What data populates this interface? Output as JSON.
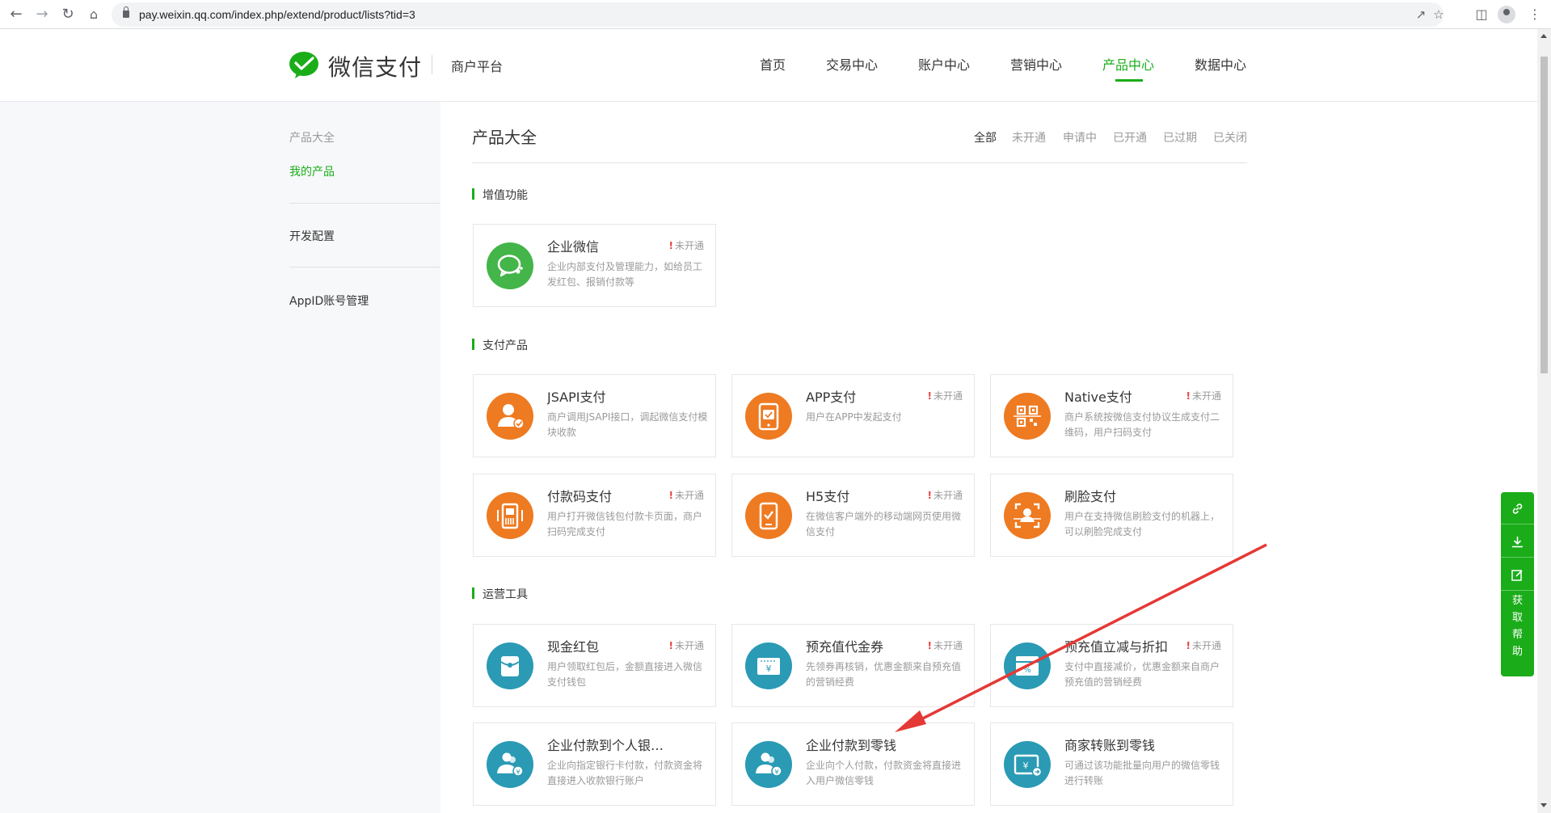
{
  "browser": {
    "url": "pay.weixin.qq.com/index.php/extend/product/lists?tid=3"
  },
  "header": {
    "logo_text": "微信支付",
    "portal": "商户平台",
    "nav": [
      "首页",
      "交易中心",
      "账户中心",
      "营销中心",
      "产品中心",
      "数据中心"
    ],
    "active_nav": "产品中心"
  },
  "sidebar": {
    "title": "产品大全",
    "items": [
      "我的产品",
      "开发配置",
      "AppID账号管理"
    ],
    "active_item": "我的产品"
  },
  "main": {
    "title": "产品大全",
    "filters": [
      "全部",
      "未开通",
      "申请中",
      "已开通",
      "已过期",
      "已关闭"
    ],
    "active_filter": "全部"
  },
  "sections": [
    {
      "title": "增值功能",
      "cards": [
        {
          "name": "企业微信",
          "status": "未开通",
          "desc": "企业内部支付及管理能力，如给员工发红包、报销付款等",
          "icon": "wework-icon",
          "color": "#44b549"
        }
      ]
    },
    {
      "title": "支付产品",
      "cards": [
        {
          "name": "JSAPI支付",
          "status": "",
          "desc": "商户调用JSAPI接口，调起微信支付模块收款",
          "icon": "jsapi-user-icon",
          "color": "#ee7a21"
        },
        {
          "name": "APP支付",
          "status": "未开通",
          "desc": "用户在APP中发起支付",
          "icon": "app-phone-icon",
          "color": "#ee7a21"
        },
        {
          "name": "Native支付",
          "status": "未开通",
          "desc": "商户系统按微信支付协议生成支付二维码，用户扫码支付",
          "icon": "qrcode-icon",
          "color": "#ee7a21"
        },
        {
          "name": "付款码支付",
          "status": "未开通",
          "desc": "用户打开微信钱包付款卡页面，商户扫码完成支付",
          "icon": "barcode-scanner-icon",
          "color": "#ee7a21"
        },
        {
          "name": "H5支付",
          "status": "未开通",
          "desc": "在微信客户端外的移动端网页使用微信支付",
          "icon": "h5-phone-icon",
          "color": "#ee7a21"
        },
        {
          "name": "刷脸支付",
          "status": "",
          "desc": "用户在支持微信刷脸支付的机器上，可以刷脸完成支付",
          "icon": "face-pay-icon",
          "color": "#ee7a21"
        }
      ]
    },
    {
      "title": "运营工具",
      "cards": [
        {
          "name": "现金红包",
          "status": "未开通",
          "desc": "用户领取红包后，金额直接进入微信支付钱包",
          "icon": "red-packet-icon",
          "color": "#2a9ab5"
        },
        {
          "name": "预充值代金券",
          "status": "未开通",
          "desc": "先领券再核销，优惠金额来自预充值的营销经费",
          "icon": "voucher-icon",
          "color": "#2a9ab5"
        },
        {
          "name": "预充值立减与折扣",
          "status": "未开通",
          "desc": "支付中直接减价，优惠金额来自商户预充值的营销经费",
          "icon": "discount-icon",
          "color": "#2a9ab5"
        },
        {
          "name": "企业付款到个人银…",
          "status": "",
          "desc": "企业向指定银行卡付款，付款资金将直接进入收款银行账户",
          "icon": "pay-to-bank-icon",
          "color": "#2a9ab5"
        },
        {
          "name": "企业付款到零钱",
          "status": "",
          "desc": "企业向个人付款，付款资金将直接进入用户微信零钱",
          "icon": "pay-to-balance-icon",
          "color": "#2a9ab5"
        },
        {
          "name": "商家转账到零钱",
          "status": "",
          "desc": "可通过该功能批量向用户的微信零钱进行转账",
          "icon": "merchant-transfer-icon",
          "color": "#2a9ab5"
        }
      ]
    }
  ],
  "float_help": {
    "icons": [
      "link-icon",
      "download-icon",
      "edit-icon"
    ],
    "label": [
      "获",
      "取",
      "帮",
      "助"
    ]
  },
  "colors": {
    "brand_green": "#1aad19",
    "orange": "#ee7a21",
    "teal": "#2a9ab5",
    "alert_red": "#e64340",
    "annotation_red": "#e53935"
  }
}
